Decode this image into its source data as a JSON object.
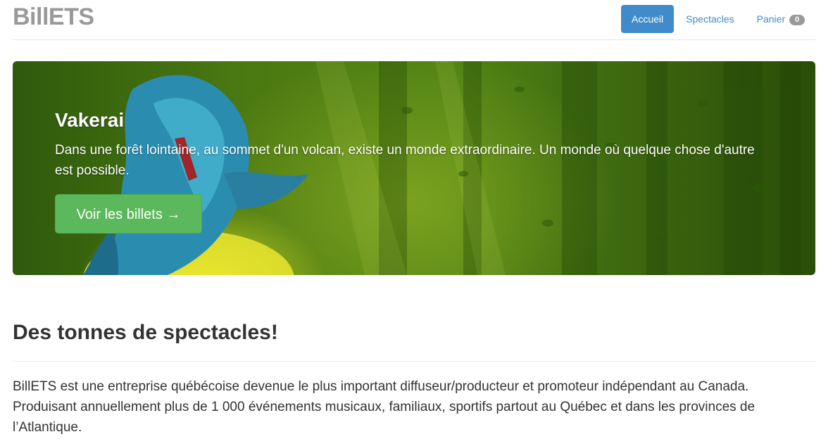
{
  "header": {
    "brand": "BillETS",
    "nav": [
      {
        "label": "Accueil",
        "active": true
      },
      {
        "label": "Spectacles",
        "active": false
      },
      {
        "label": "Panier",
        "active": false,
        "badge": "0"
      }
    ]
  },
  "hero": {
    "title": "Vakerai",
    "text": "Dans une forêt lointaine, au sommet d'un volcan, existe un monde extraordinaire. Un monde où quelque chose d'autre est possible.",
    "button_label": "Voir les billets →"
  },
  "section": {
    "title": "Des tonnes de spectacles!",
    "text": "BillETS est une entreprise québécoise devenue le plus important diffuseur/producteur et promoteur indépendant au Canada. Produisant annuellement plus de 1 000 événements musicaux, familiaux, sportifs partout au Québec et dans les provinces de l’Atlantique."
  },
  "colors": {
    "primary": "#428bca",
    "success": "#5cb85c",
    "brand_gray": "#999999"
  }
}
